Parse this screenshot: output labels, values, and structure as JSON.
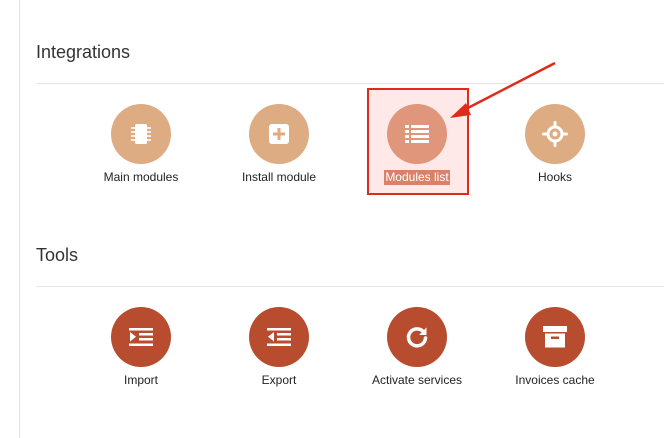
{
  "sections": [
    {
      "title": "Integrations",
      "tiles": [
        {
          "label": "Main modules",
          "icon": "chip-icon"
        },
        {
          "label": "Install module",
          "icon": "plus-square-icon"
        },
        {
          "label": "Modules list",
          "icon": "list-icon",
          "selected": true
        },
        {
          "label": "Hooks",
          "icon": "crosshair-icon"
        }
      ]
    },
    {
      "title": "Tools",
      "tiles": [
        {
          "label": "Import",
          "icon": "import-icon"
        },
        {
          "label": "Export",
          "icon": "export-icon"
        },
        {
          "label": "Activate services",
          "icon": "refresh-icon"
        },
        {
          "label": "Invoices cache",
          "icon": "archive-box-icon"
        }
      ]
    }
  ],
  "colors": {
    "integrations_icon_bg": "#ddac83",
    "selected_icon_bg": "#e0967a",
    "tools_icon_bg": "#b84c2e",
    "annotation_red": "#e02a1a"
  }
}
